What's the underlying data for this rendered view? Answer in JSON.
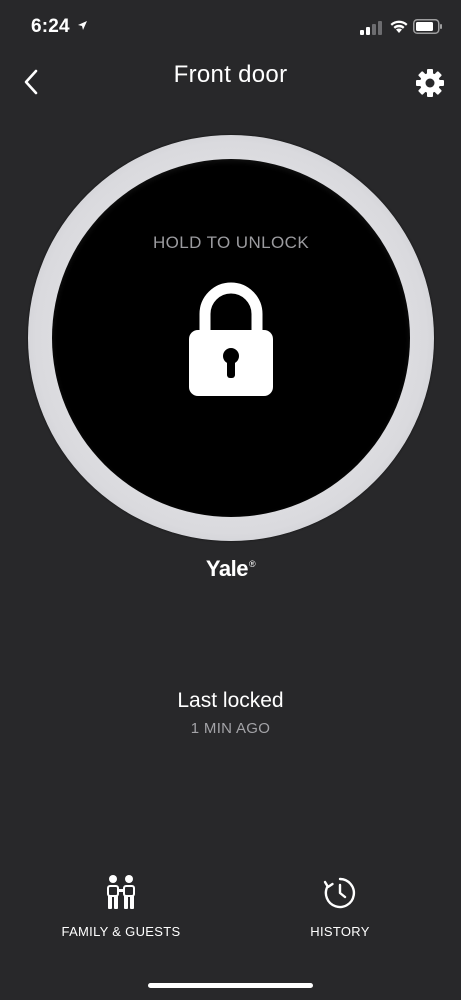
{
  "status_bar": {
    "time": "6:24"
  },
  "header": {
    "title": "Front door"
  },
  "lock": {
    "action_label": "HOLD TO UNLOCK",
    "state": "locked"
  },
  "brand": {
    "name": "Yale",
    "mark": "®"
  },
  "activity": {
    "title": "Last locked",
    "time": "1 MIN AGO"
  },
  "tabs": [
    {
      "label": "FAMILY & GUESTS",
      "icon": "family-icon"
    },
    {
      "label": "HISTORY",
      "icon": "clock-icon"
    }
  ],
  "colors": {
    "background": "#28282a",
    "ring": "#dadade",
    "face": "#000000",
    "muted_text": "#9b9b9f"
  }
}
